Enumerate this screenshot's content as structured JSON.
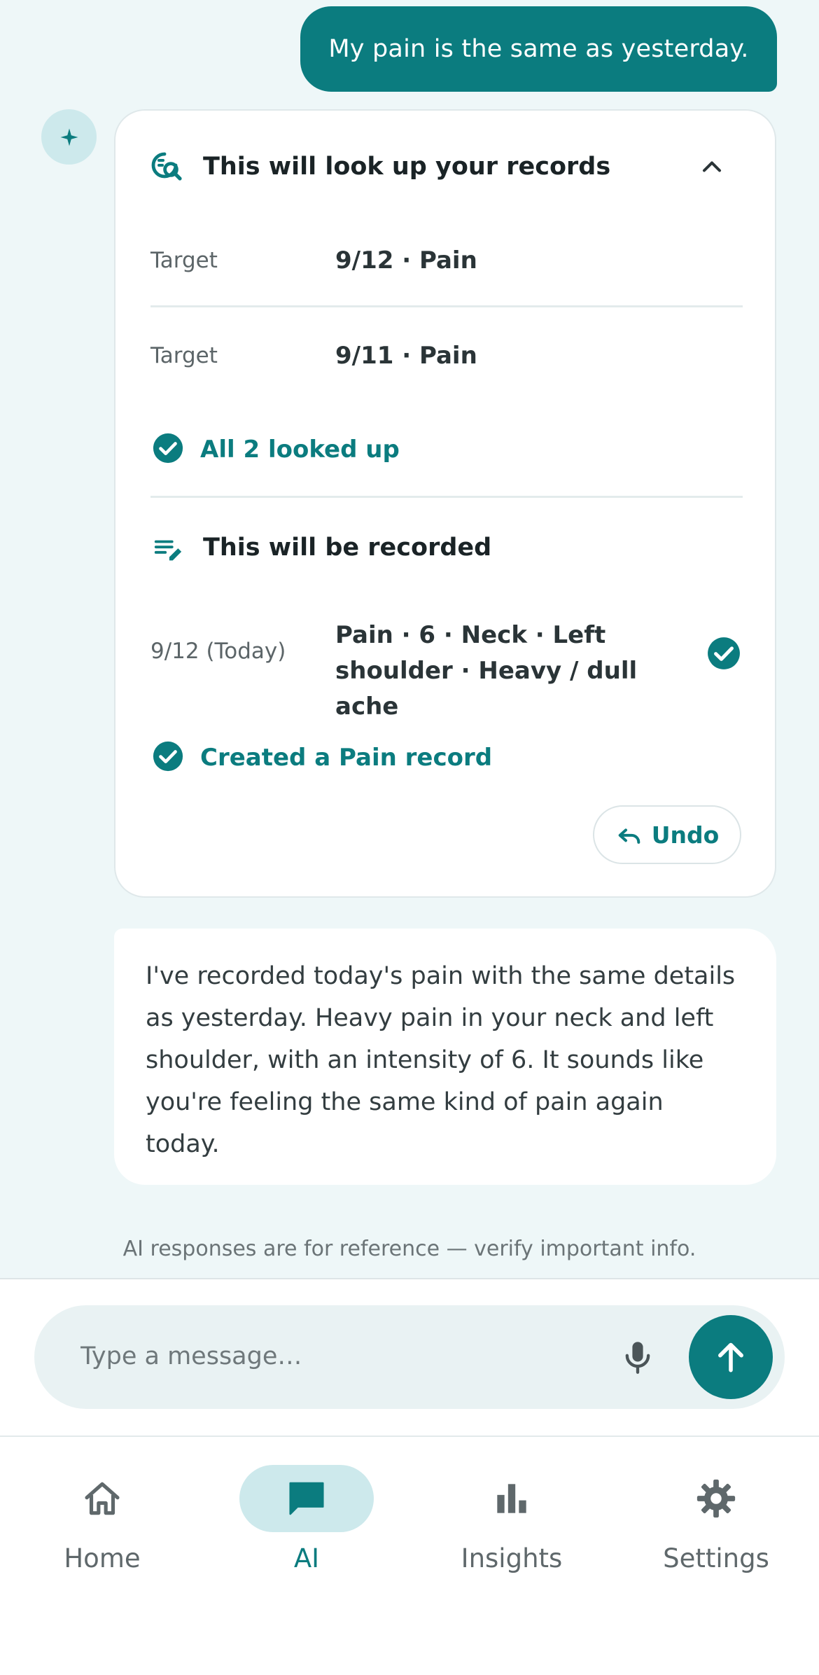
{
  "user_message": "My pain is the same as yesterday.",
  "lookup_card": {
    "title": "This will look up your records",
    "rows": [
      {
        "label": "Target",
        "value": "9/12 · Pain"
      },
      {
        "label": "Target",
        "value": "9/11 · Pain"
      }
    ],
    "lookup_status": "All 2 looked up",
    "record_section": {
      "title": "This will be recorded",
      "date": "9/12 (Today)",
      "detail": "Pain · 6 · Neck · Left shoulder · Heavy / dull ache"
    },
    "record_status": "Created a Pain record",
    "undo_label": "Undo"
  },
  "ai_message": "I've recorded today's pain with the same details as yesterday. Heavy pain in your neck and left shoulder, with an intensity of 6. It sounds like you're feeling the same kind of pain again today.",
  "disclaimer": "AI responses are for reference — verify important info.",
  "composer": {
    "placeholder": "Type a message…",
    "value": ""
  },
  "nav": {
    "items": [
      {
        "label": "Home",
        "icon": "home-icon",
        "active": false
      },
      {
        "label": "AI",
        "icon": "chat-icon",
        "active": true
      },
      {
        "label": "Insights",
        "icon": "bar-chart-icon",
        "active": false
      },
      {
        "label": "Settings",
        "icon": "gear-icon",
        "active": false
      }
    ]
  },
  "colors": {
    "accent": "#0b7c7f",
    "background": "#eef7f8",
    "accent_soft": "#cde9ec"
  }
}
